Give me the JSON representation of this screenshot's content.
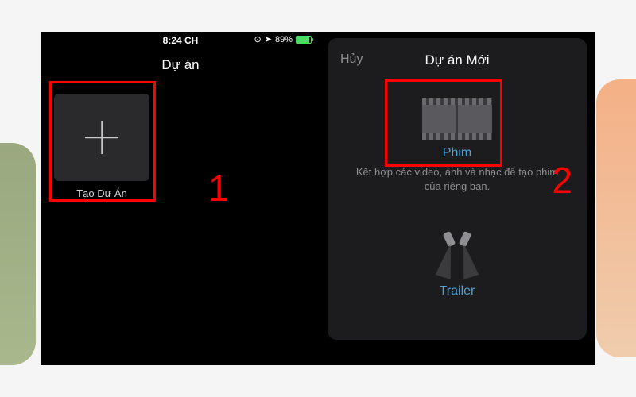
{
  "status": {
    "time": "8:24 CH",
    "battery_pct": "89%"
  },
  "left": {
    "header_title": "Dự án",
    "create_label": "Tạo Dự Án",
    "step": "1"
  },
  "right": {
    "cancel": "Hủy",
    "header_title": "Dự án Mới",
    "step": "2",
    "movie": {
      "title": "Phim",
      "desc": "Kết hợp các video, ảnh và nhạc để tạo phim của riêng bạn."
    },
    "trailer": {
      "title": "Trailer"
    }
  }
}
